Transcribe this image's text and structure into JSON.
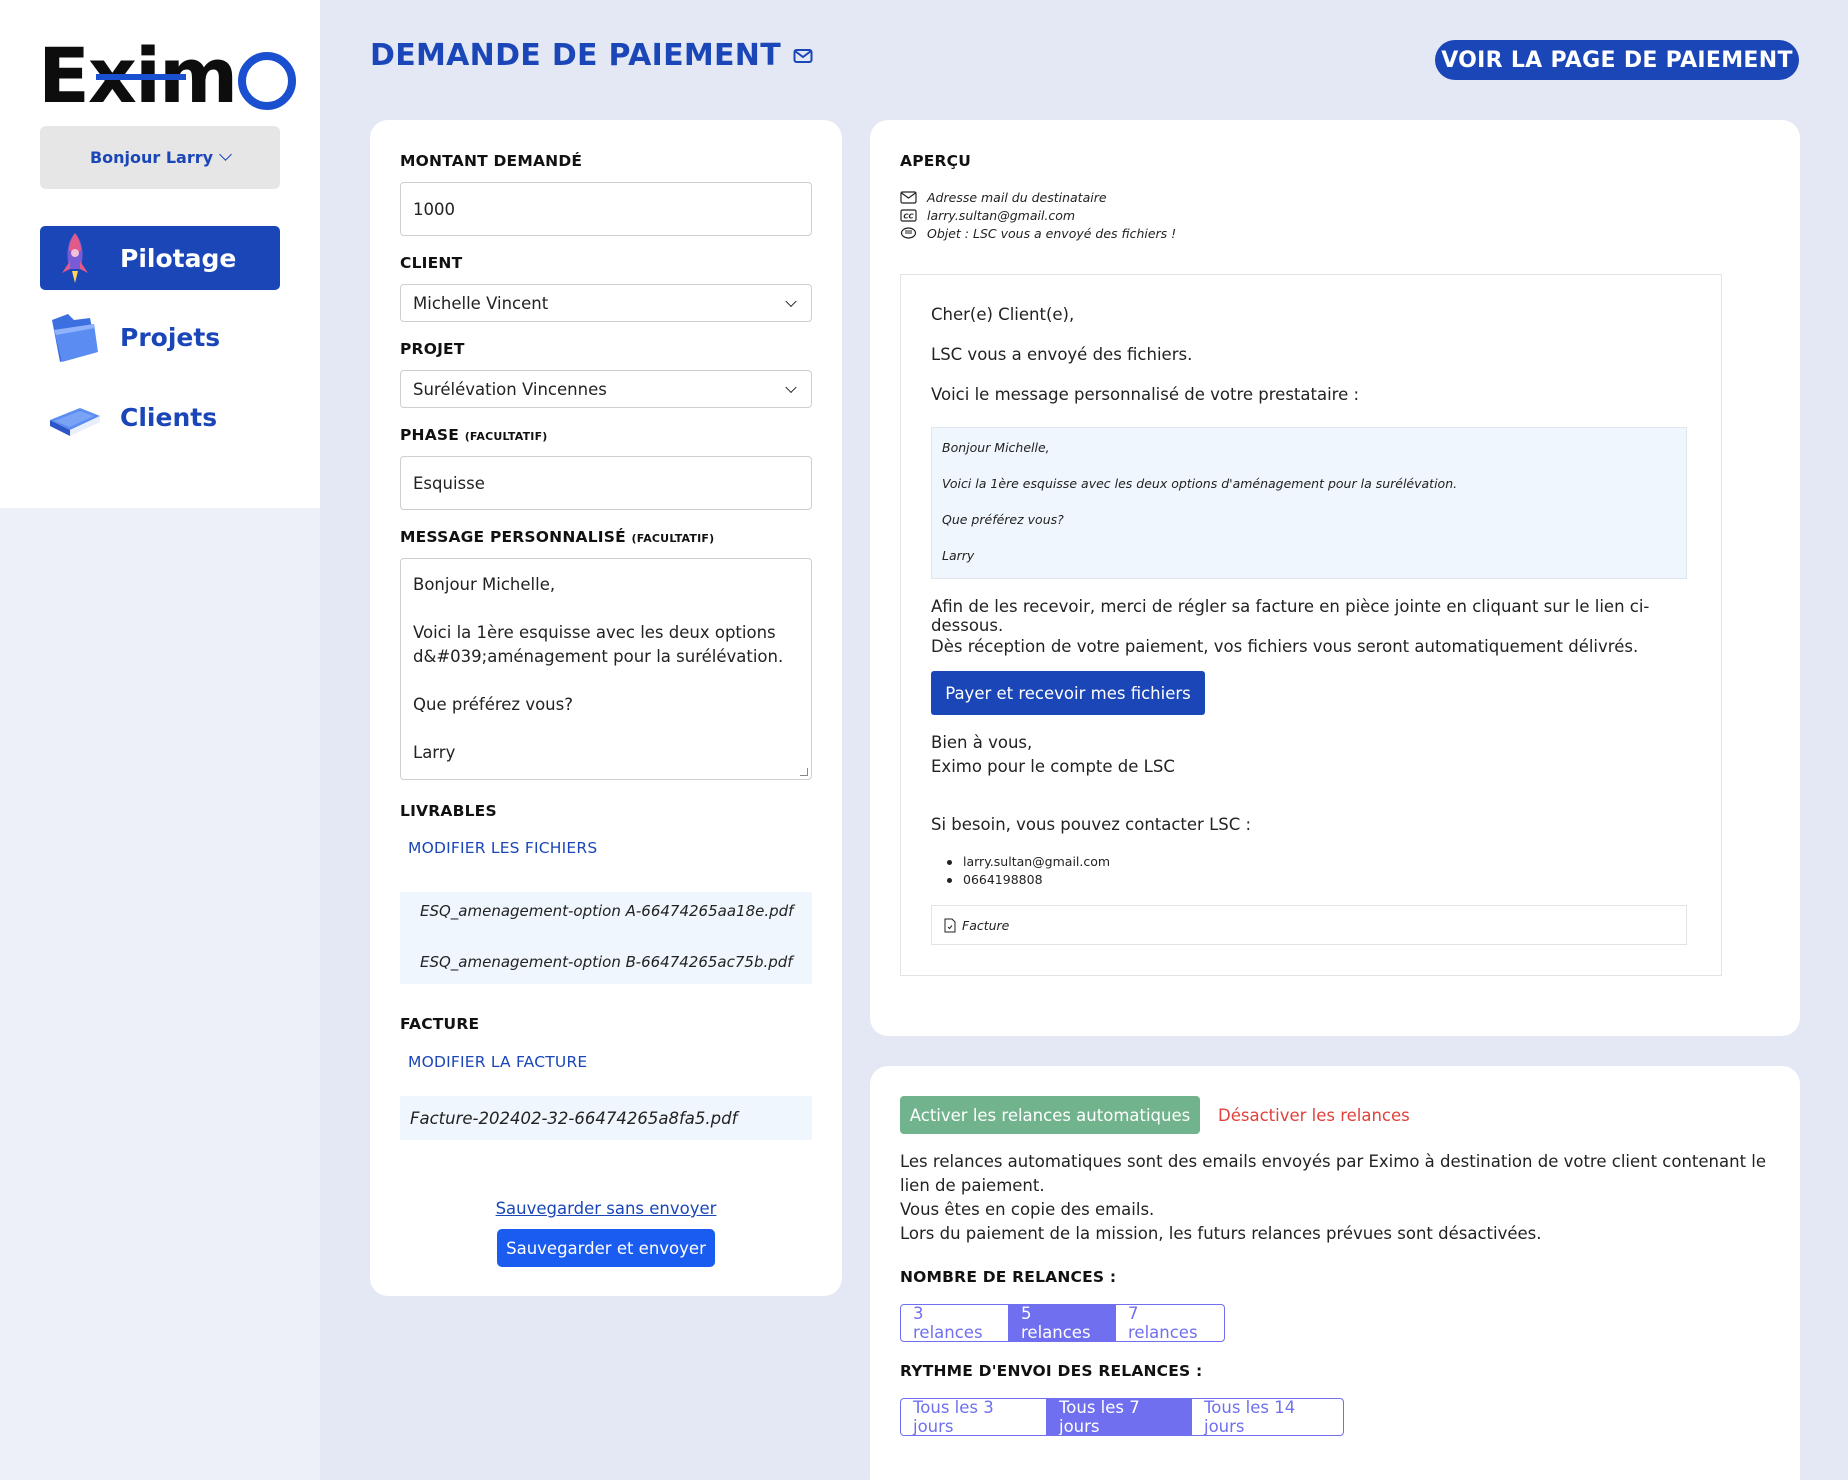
{
  "sidebar": {
    "logo": {
      "part1": "Ex",
      "part2": "im",
      "part3": ""
    },
    "user_greeting": "Bonjour Larry",
    "items": [
      {
        "label": "Pilotage",
        "icon": "rocket-icon",
        "active": true
      },
      {
        "label": "Projets",
        "icon": "folder-icon",
        "active": false
      },
      {
        "label": "Clients",
        "icon": "book-icon",
        "active": false
      }
    ]
  },
  "header": {
    "title": "DEMANDE DE PAIEMENT",
    "title_icon": "mail-icon",
    "view_button": "VOIR LA PAGE DE PAIEMENT"
  },
  "form": {
    "amount_label": "MONTANT DEMANDÉ",
    "amount_value": "1000",
    "client_label": "CLIENT",
    "client_value": "Michelle Vincent",
    "project_label": "PROJET",
    "project_value": "Surélévation Vincennes",
    "phase_label": "PHASE",
    "phase_optional": "(FACULTATIF)",
    "phase_value": "Esquisse",
    "message_label": "MESSAGE PERSONNALISÉ",
    "message_optional": "(FACULTATIF)",
    "message_lines": [
      "Bonjour Michelle,",
      "",
      "Voici la 1ère esquisse avec les deux options d&#039;aménagement pour la surélévation.",
      "",
      "Que préférez vous?",
      "",
      "Larry"
    ],
    "deliverables_label": "LIVRABLES",
    "modify_files": "MODIFIER LES FICHIERS",
    "files": [
      "ESQ_amenagement-option A-66474265aa18e.pdf",
      "ESQ_amenagement-option B-66474265ac75b.pdf"
    ],
    "invoice_label": "FACTURE",
    "modify_invoice": "MODIFIER LA FACTURE",
    "invoice_file": "Facture-202402-32-66474265a8fa5.pdf",
    "save_without_sending": "Sauvegarder sans envoyer",
    "save_and_send": "Sauvegarder et envoyer"
  },
  "preview": {
    "title": "APERÇU",
    "recipient": "Adresse mail du destinataire",
    "cc": "larry.sultan@gmail.com",
    "subject": "Objet : LSC vous a envoyé des fichiers !",
    "greeting": "Cher(e) Client(e),",
    "line1": "LSC vous a envoyé des fichiers.",
    "line2": "Voici le message personnalisé de votre prestataire :",
    "quote": [
      "Bonjour Michelle,",
      "Voici la 1ère esquisse avec les deux options d'aménagement pour la surélévation.",
      "Que préférez vous?",
      "Larry"
    ],
    "line3": "Afin de les recevoir, merci de régler sa facture en pièce jointe en cliquant sur le lien ci-dessous.",
    "line4": "Dès réception de votre paiement, vos fichiers vous seront automatiquement délivrés.",
    "pay_button": "Payer et recevoir mes fichiers",
    "signoff1": "Bien à vous,",
    "signoff2": "Eximo pour le compte de LSC",
    "contact_intro": "Si besoin, vous pouvez contacter LSC :",
    "contacts": [
      "larry.sultan@gmail.com",
      "0664198808"
    ],
    "attachment": "Facture"
  },
  "relances": {
    "activate": "Activer les relances automatiques",
    "deactivate": "Désactiver les relances",
    "description": [
      "Les relances automatiques sont des emails envoyés par Eximo à destination de votre client contenant le lien de paiement.",
      "Vous êtes en copie des emails.",
      "Lors du paiement de la mission, les futurs relances prévues sont désactivées."
    ],
    "count_label": "NOMBRE DE RELANCES :",
    "count_options": [
      "3 relances",
      "5 relances",
      "7 relances"
    ],
    "count_selected": "5 relances",
    "rhythm_label": "RYTHME D'ENVOI DES RELANCES :",
    "rhythm_options": [
      "Tous les 3 jours",
      "Tous les 7 jours",
      "Tous les 14 jours"
    ],
    "rhythm_selected": "Tous les 7 jours"
  },
  "colors": {
    "brand_blue": "#1a46b8",
    "activate_green": "#71b38d",
    "deactivate_red": "#e0413a",
    "segment_purple": "#6f6ff0",
    "page_bg": "#e4e8f4"
  }
}
